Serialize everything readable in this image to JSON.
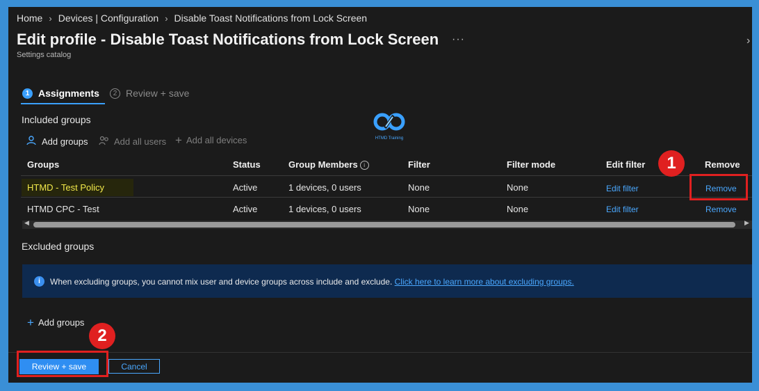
{
  "breadcrumb": {
    "items": [
      "Home",
      "Devices | Configuration",
      "Disable Toast Notifications from Lock Screen"
    ]
  },
  "header": {
    "title": "Edit profile - Disable Toast Notifications from Lock Screen",
    "subtitle": "Settings catalog",
    "more": "···"
  },
  "wizard": {
    "steps": [
      {
        "number": "1",
        "label": "Assignments",
        "active": true
      },
      {
        "number": "2",
        "label": "Review + save",
        "active": false
      }
    ]
  },
  "logo": {
    "text": "HTMD Training"
  },
  "included": {
    "title": "Included groups",
    "commands": {
      "add_groups": "Add groups",
      "add_all_users": "Add all users",
      "add_all_devices": "Add all devices"
    },
    "columns": [
      "Groups",
      "Status",
      "Group Members",
      "Filter",
      "Filter mode",
      "Edit filter",
      "Remove"
    ],
    "rows": [
      {
        "group": "HTMD - Test Policy",
        "status": "Active",
        "members": "1 devices, 0 users",
        "filter": "None",
        "filter_mode": "None",
        "edit_filter": "Edit filter",
        "remove": "Remove"
      },
      {
        "group": "HTMD CPC - Test",
        "status": "Active",
        "members": "1 devices, 0 users",
        "filter": "None",
        "filter_mode": "None",
        "edit_filter": "Edit filter",
        "remove": "Remove"
      }
    ]
  },
  "excluded": {
    "title": "Excluded groups",
    "banner_text": "When excluding groups, you cannot mix user and device groups across include and exclude.",
    "banner_link": "Click here to learn more about excluding groups.",
    "add_groups": "Add groups"
  },
  "footer": {
    "primary": "Review + save",
    "secondary": "Cancel"
  },
  "annotations": {
    "marker1": "1",
    "marker2": "2"
  },
  "colors": {
    "accent": "#2f8ef2",
    "link": "#4aa8ff",
    "annotation": "#e02020",
    "background": "#1b1b1b"
  }
}
